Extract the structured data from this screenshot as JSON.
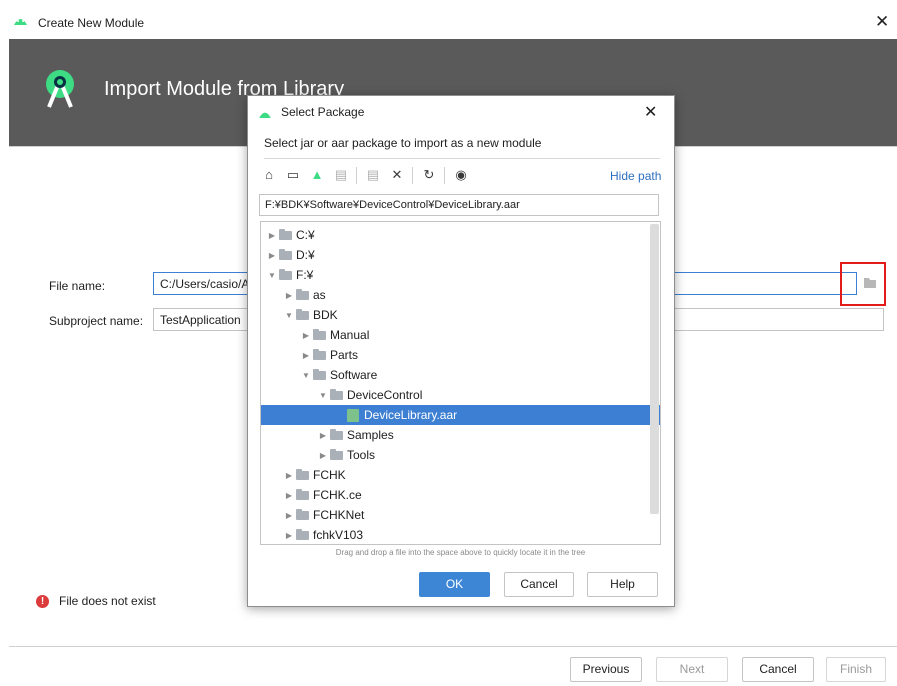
{
  "window": {
    "title": "Create New Module",
    "close_glyph": "✕"
  },
  "header": {
    "title": "Import Module from Library"
  },
  "form": {
    "file_name_label": "File name:",
    "file_name_value": "C:/Users/casio/A",
    "subproject_label": "Subproject name:",
    "subproject_value": "TestApplication",
    "browse_icon": "folder-open-icon"
  },
  "error": {
    "text": "File does not exist",
    "icon": "error-icon",
    "color": "#db3b3b"
  },
  "footer": {
    "previous": "Previous",
    "next": "Next",
    "cancel": "Cancel",
    "finish": "Finish"
  },
  "dialog": {
    "title": "Select Package",
    "description": "Select jar or aar package to import as a new module",
    "hide_path": "Hide path",
    "path": "F:¥BDK¥Software¥DeviceControl¥DeviceLibrary.aar",
    "drag_hint": "Drag and drop a file into the space above to quickly locate it in the tree",
    "ok": "OK",
    "cancel": "Cancel",
    "help": "Help",
    "toolbar_icons": [
      "home-icon",
      "desktop-icon",
      "android-project-icon",
      "module-icon",
      "new-folder-icon",
      "delete-icon",
      "refresh-icon",
      "show-hidden-icon"
    ],
    "tree": [
      {
        "label": "C:¥",
        "state": "collapsed"
      },
      {
        "label": "D:¥",
        "state": "collapsed"
      },
      {
        "label": "F:¥",
        "state": "expanded"
      },
      {
        "label": "as",
        "state": "collapsed"
      },
      {
        "label": "BDK",
        "state": "expanded"
      },
      {
        "label": "Manual",
        "state": "collapsed"
      },
      {
        "label": "Parts",
        "state": "collapsed"
      },
      {
        "label": "Software",
        "state": "expanded"
      },
      {
        "label": "DeviceControl",
        "state": "expanded"
      },
      {
        "label": "DeviceLibrary.aar",
        "state": "file",
        "selected": true
      },
      {
        "label": "Samples",
        "state": "collapsed"
      },
      {
        "label": "Tools",
        "state": "collapsed"
      },
      {
        "label": "FCHK",
        "state": "collapsed"
      },
      {
        "label": "FCHK.ce",
        "state": "collapsed"
      },
      {
        "label": "FCHKNet",
        "state": "collapsed"
      },
      {
        "label": "fchkV103",
        "state": "collapsed"
      }
    ]
  },
  "colors": {
    "header_bg": "#5a5a5a",
    "accent": "#3d7fd2",
    "highlight_box": "#e31b1b"
  }
}
